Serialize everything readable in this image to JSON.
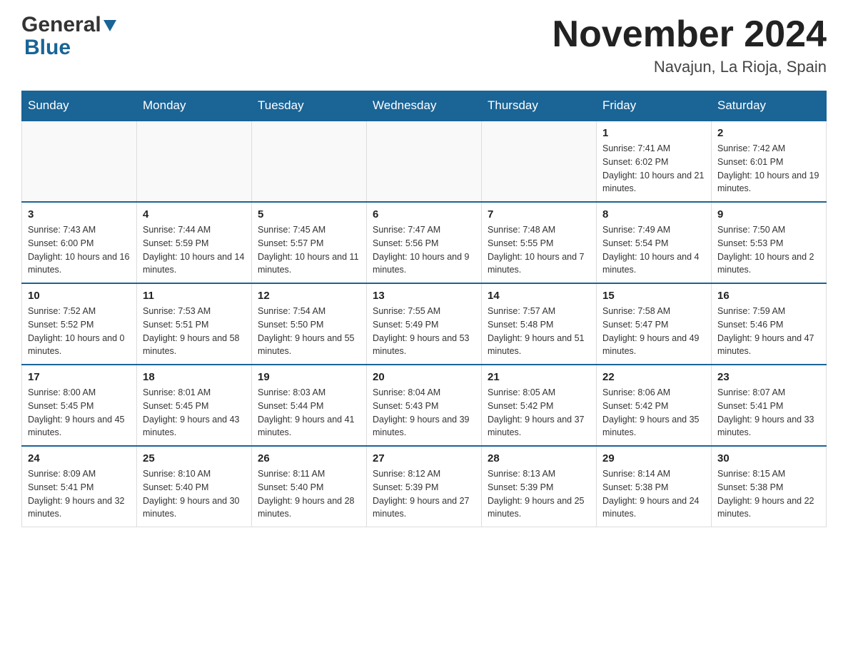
{
  "header": {
    "logo_general": "General",
    "logo_blue": "Blue",
    "month_title": "November 2024",
    "location": "Navajun, La Rioja, Spain"
  },
  "calendar": {
    "days_of_week": [
      "Sunday",
      "Monday",
      "Tuesday",
      "Wednesday",
      "Thursday",
      "Friday",
      "Saturday"
    ],
    "weeks": [
      {
        "days": [
          {
            "num": "",
            "sunrise": "",
            "sunset": "",
            "daylight": ""
          },
          {
            "num": "",
            "sunrise": "",
            "sunset": "",
            "daylight": ""
          },
          {
            "num": "",
            "sunrise": "",
            "sunset": "",
            "daylight": ""
          },
          {
            "num": "",
            "sunrise": "",
            "sunset": "",
            "daylight": ""
          },
          {
            "num": "",
            "sunrise": "",
            "sunset": "",
            "daylight": ""
          },
          {
            "num": "1",
            "sunrise": "Sunrise: 7:41 AM",
            "sunset": "Sunset: 6:02 PM",
            "daylight": "Daylight: 10 hours and 21 minutes."
          },
          {
            "num": "2",
            "sunrise": "Sunrise: 7:42 AM",
            "sunset": "Sunset: 6:01 PM",
            "daylight": "Daylight: 10 hours and 19 minutes."
          }
        ]
      },
      {
        "days": [
          {
            "num": "3",
            "sunrise": "Sunrise: 7:43 AM",
            "sunset": "Sunset: 6:00 PM",
            "daylight": "Daylight: 10 hours and 16 minutes."
          },
          {
            "num": "4",
            "sunrise": "Sunrise: 7:44 AM",
            "sunset": "Sunset: 5:59 PM",
            "daylight": "Daylight: 10 hours and 14 minutes."
          },
          {
            "num": "5",
            "sunrise": "Sunrise: 7:45 AM",
            "sunset": "Sunset: 5:57 PM",
            "daylight": "Daylight: 10 hours and 11 minutes."
          },
          {
            "num": "6",
            "sunrise": "Sunrise: 7:47 AM",
            "sunset": "Sunset: 5:56 PM",
            "daylight": "Daylight: 10 hours and 9 minutes."
          },
          {
            "num": "7",
            "sunrise": "Sunrise: 7:48 AM",
            "sunset": "Sunset: 5:55 PM",
            "daylight": "Daylight: 10 hours and 7 minutes."
          },
          {
            "num": "8",
            "sunrise": "Sunrise: 7:49 AM",
            "sunset": "Sunset: 5:54 PM",
            "daylight": "Daylight: 10 hours and 4 minutes."
          },
          {
            "num": "9",
            "sunrise": "Sunrise: 7:50 AM",
            "sunset": "Sunset: 5:53 PM",
            "daylight": "Daylight: 10 hours and 2 minutes."
          }
        ]
      },
      {
        "days": [
          {
            "num": "10",
            "sunrise": "Sunrise: 7:52 AM",
            "sunset": "Sunset: 5:52 PM",
            "daylight": "Daylight: 10 hours and 0 minutes."
          },
          {
            "num": "11",
            "sunrise": "Sunrise: 7:53 AM",
            "sunset": "Sunset: 5:51 PM",
            "daylight": "Daylight: 9 hours and 58 minutes."
          },
          {
            "num": "12",
            "sunrise": "Sunrise: 7:54 AM",
            "sunset": "Sunset: 5:50 PM",
            "daylight": "Daylight: 9 hours and 55 minutes."
          },
          {
            "num": "13",
            "sunrise": "Sunrise: 7:55 AM",
            "sunset": "Sunset: 5:49 PM",
            "daylight": "Daylight: 9 hours and 53 minutes."
          },
          {
            "num": "14",
            "sunrise": "Sunrise: 7:57 AM",
            "sunset": "Sunset: 5:48 PM",
            "daylight": "Daylight: 9 hours and 51 minutes."
          },
          {
            "num": "15",
            "sunrise": "Sunrise: 7:58 AM",
            "sunset": "Sunset: 5:47 PM",
            "daylight": "Daylight: 9 hours and 49 minutes."
          },
          {
            "num": "16",
            "sunrise": "Sunrise: 7:59 AM",
            "sunset": "Sunset: 5:46 PM",
            "daylight": "Daylight: 9 hours and 47 minutes."
          }
        ]
      },
      {
        "days": [
          {
            "num": "17",
            "sunrise": "Sunrise: 8:00 AM",
            "sunset": "Sunset: 5:45 PM",
            "daylight": "Daylight: 9 hours and 45 minutes."
          },
          {
            "num": "18",
            "sunrise": "Sunrise: 8:01 AM",
            "sunset": "Sunset: 5:45 PM",
            "daylight": "Daylight: 9 hours and 43 minutes."
          },
          {
            "num": "19",
            "sunrise": "Sunrise: 8:03 AM",
            "sunset": "Sunset: 5:44 PM",
            "daylight": "Daylight: 9 hours and 41 minutes."
          },
          {
            "num": "20",
            "sunrise": "Sunrise: 8:04 AM",
            "sunset": "Sunset: 5:43 PM",
            "daylight": "Daylight: 9 hours and 39 minutes."
          },
          {
            "num": "21",
            "sunrise": "Sunrise: 8:05 AM",
            "sunset": "Sunset: 5:42 PM",
            "daylight": "Daylight: 9 hours and 37 minutes."
          },
          {
            "num": "22",
            "sunrise": "Sunrise: 8:06 AM",
            "sunset": "Sunset: 5:42 PM",
            "daylight": "Daylight: 9 hours and 35 minutes."
          },
          {
            "num": "23",
            "sunrise": "Sunrise: 8:07 AM",
            "sunset": "Sunset: 5:41 PM",
            "daylight": "Daylight: 9 hours and 33 minutes."
          }
        ]
      },
      {
        "days": [
          {
            "num": "24",
            "sunrise": "Sunrise: 8:09 AM",
            "sunset": "Sunset: 5:41 PM",
            "daylight": "Daylight: 9 hours and 32 minutes."
          },
          {
            "num": "25",
            "sunrise": "Sunrise: 8:10 AM",
            "sunset": "Sunset: 5:40 PM",
            "daylight": "Daylight: 9 hours and 30 minutes."
          },
          {
            "num": "26",
            "sunrise": "Sunrise: 8:11 AM",
            "sunset": "Sunset: 5:40 PM",
            "daylight": "Daylight: 9 hours and 28 minutes."
          },
          {
            "num": "27",
            "sunrise": "Sunrise: 8:12 AM",
            "sunset": "Sunset: 5:39 PM",
            "daylight": "Daylight: 9 hours and 27 minutes."
          },
          {
            "num": "28",
            "sunrise": "Sunrise: 8:13 AM",
            "sunset": "Sunset: 5:39 PM",
            "daylight": "Daylight: 9 hours and 25 minutes."
          },
          {
            "num": "29",
            "sunrise": "Sunrise: 8:14 AM",
            "sunset": "Sunset: 5:38 PM",
            "daylight": "Daylight: 9 hours and 24 minutes."
          },
          {
            "num": "30",
            "sunrise": "Sunrise: 8:15 AM",
            "sunset": "Sunset: 5:38 PM",
            "daylight": "Daylight: 9 hours and 22 minutes."
          }
        ]
      }
    ]
  }
}
